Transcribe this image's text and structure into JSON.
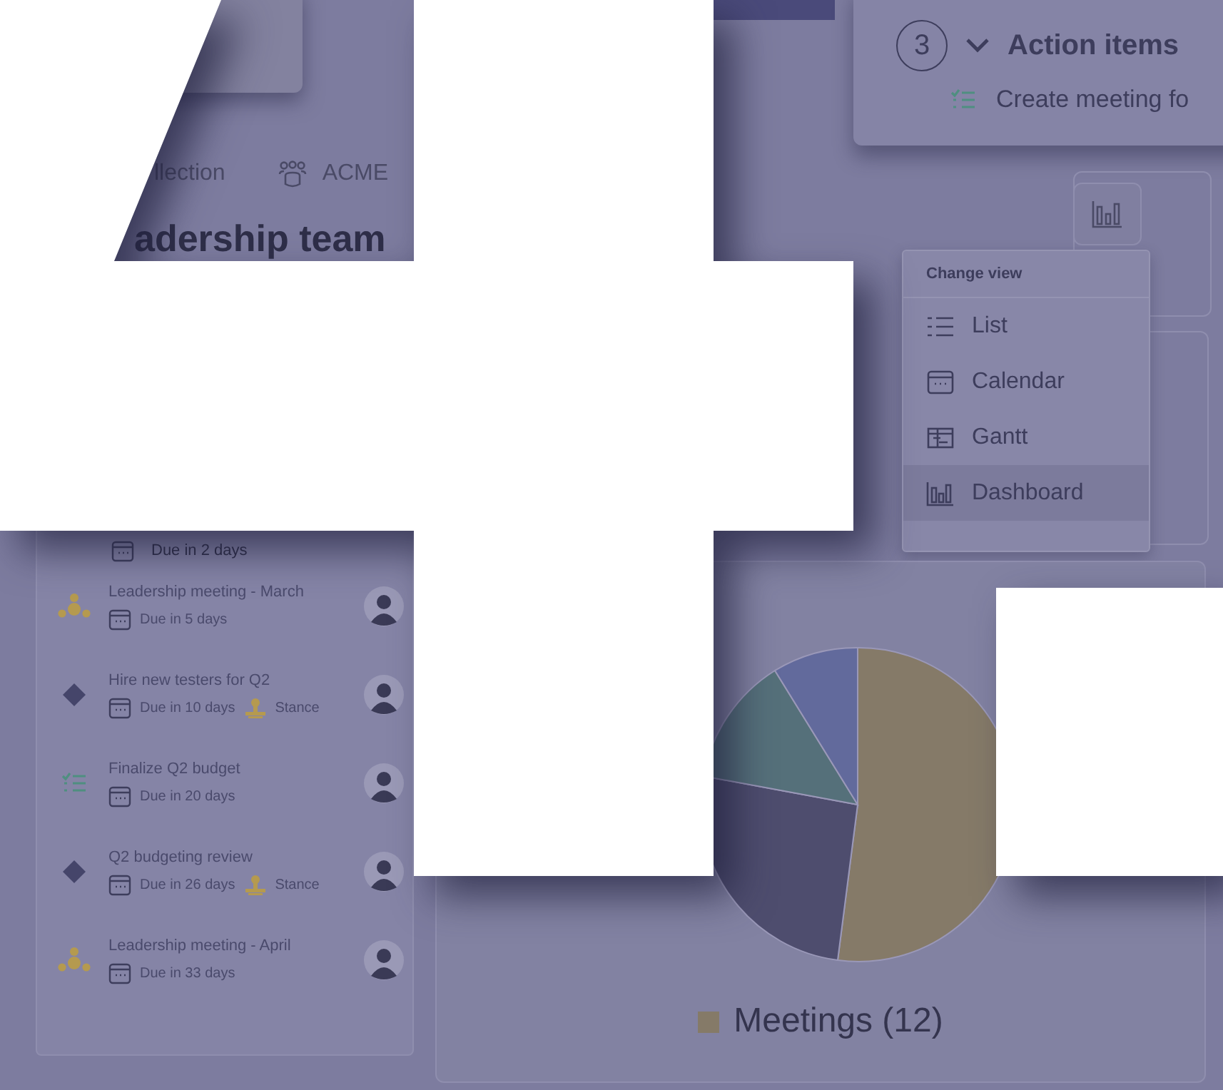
{
  "breadcrumb": {
    "collection": "llection",
    "workspace": "ACME"
  },
  "page_title": "adership team",
  "action_card": {
    "step": "3",
    "title": "Action items",
    "item": "Create meeting fo"
  },
  "view_menu": {
    "header": "Change view",
    "items": [
      {
        "label": "List",
        "selected": false
      },
      {
        "label": "Calendar",
        "selected": false
      },
      {
        "label": "Gantt",
        "selected": false
      },
      {
        "label": "Dashboard",
        "selected": true
      }
    ]
  },
  "partial_due": "Due in 2 days",
  "tasks": [
    {
      "kind": "meeting",
      "title": "Leadership meeting - March",
      "due": "Due in 5 days"
    },
    {
      "kind": "milestone",
      "title": "Hire new testers for Q2",
      "due": "Due in 10 days",
      "tag": "Stance"
    },
    {
      "kind": "task",
      "title": "Finalize Q2 budget",
      "due": "Due in 20 days"
    },
    {
      "kind": "milestone",
      "title": "Q2 budgeting review",
      "due": "Due in 26 days",
      "tag": "Stance"
    },
    {
      "kind": "meeting",
      "title": "Leadership meeting - April",
      "due": "Due in 33 days"
    }
  ],
  "legend": [
    {
      "label": "Meetings (12)",
      "color": "#857a68"
    }
  ]
}
